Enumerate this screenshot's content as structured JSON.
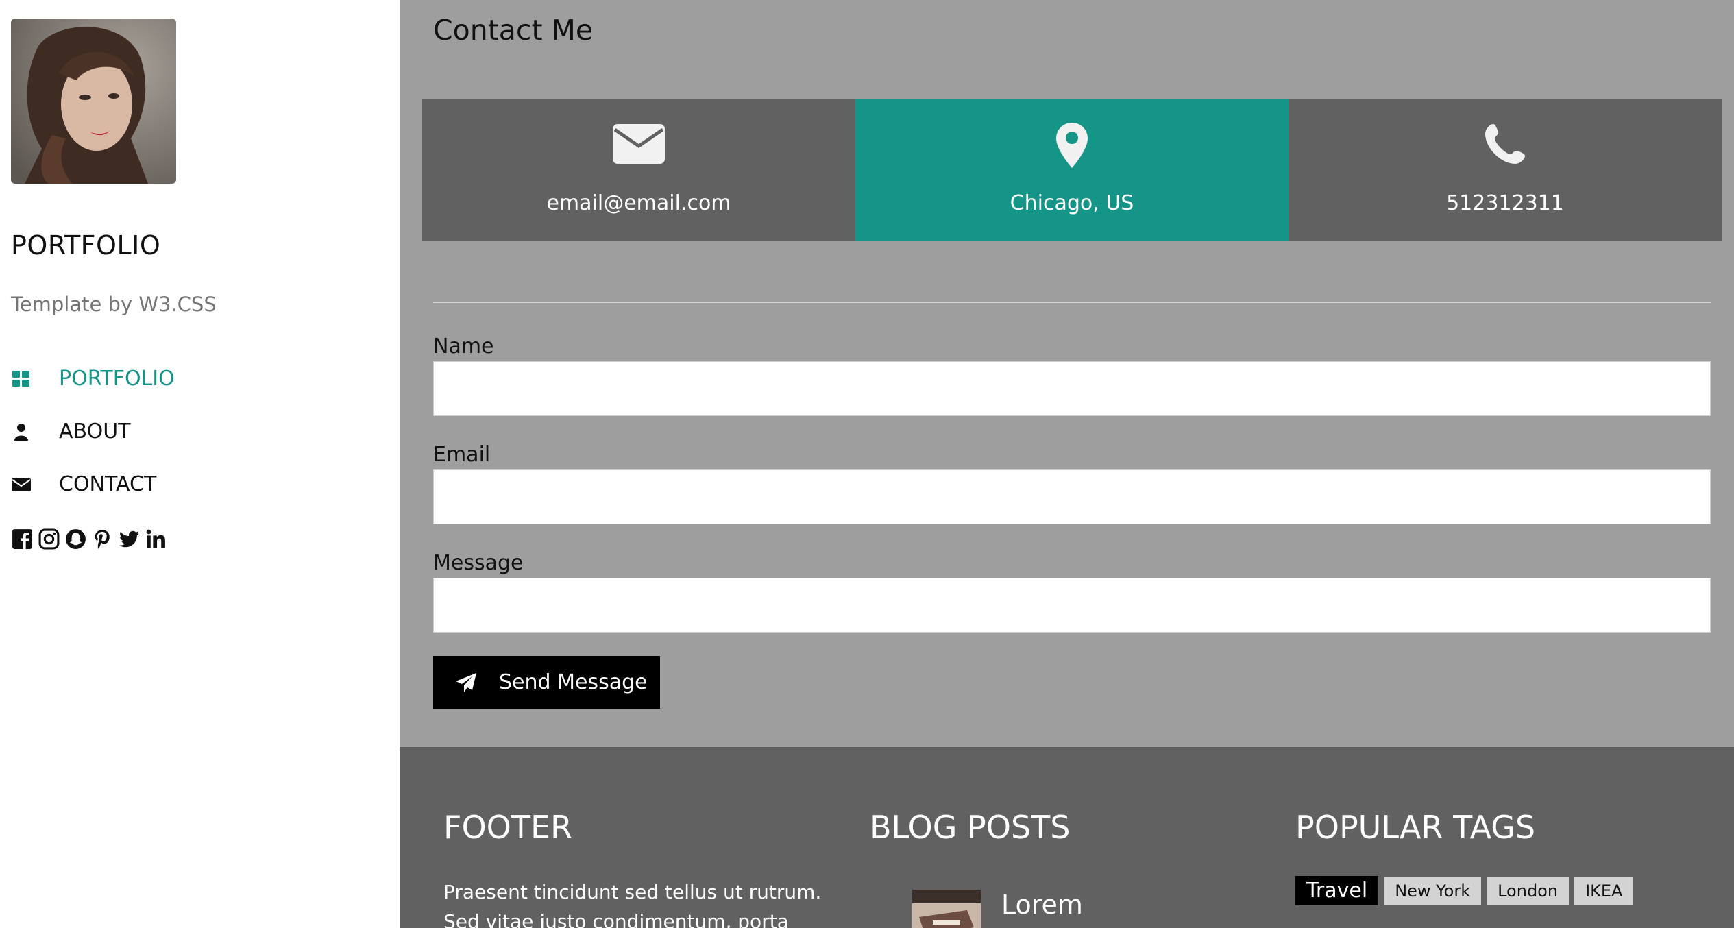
{
  "sidebar": {
    "title": "PORTFOLIO",
    "subtitle": "Template by W3.CSS",
    "nav": [
      {
        "label": "PORTFOLIO",
        "icon": "grid-icon",
        "active": true
      },
      {
        "label": "ABOUT",
        "icon": "user-icon",
        "active": false
      },
      {
        "label": "CONTACT",
        "icon": "envelope-icon",
        "active": false
      }
    ],
    "social_icons": [
      "facebook-icon",
      "instagram-icon",
      "snapchat-icon",
      "pinterest-icon",
      "twitter-icon",
      "linkedin-icon"
    ]
  },
  "contact": {
    "heading": "Contact Me",
    "cards": [
      {
        "icon": "envelope-icon",
        "text": "email@email.com"
      },
      {
        "icon": "map-marker-icon",
        "text": "Chicago, US"
      },
      {
        "icon": "phone-icon",
        "text": "512312311"
      }
    ],
    "form": {
      "name_label": "Name",
      "name_value": "",
      "email_label": "Email",
      "email_value": "",
      "message_label": "Message",
      "message_value": "",
      "submit_label": "Send Message"
    }
  },
  "footer": {
    "col1_heading": "FOOTER",
    "col1_text": "Praesent tincidunt sed tellus ut rutrum. Sed vitae justo condimentum, porta lectus",
    "col2_heading": "BLOG POSTS",
    "blog_post_title": "Lorem",
    "col3_heading": "POPULAR TAGS",
    "tags": [
      "Travel",
      "New York",
      "London",
      "IKEA"
    ]
  },
  "colors": {
    "accent": "#159488",
    "main_bg": "#9e9e9e",
    "card_bg": "#616161",
    "footer_bg": "#616161"
  }
}
